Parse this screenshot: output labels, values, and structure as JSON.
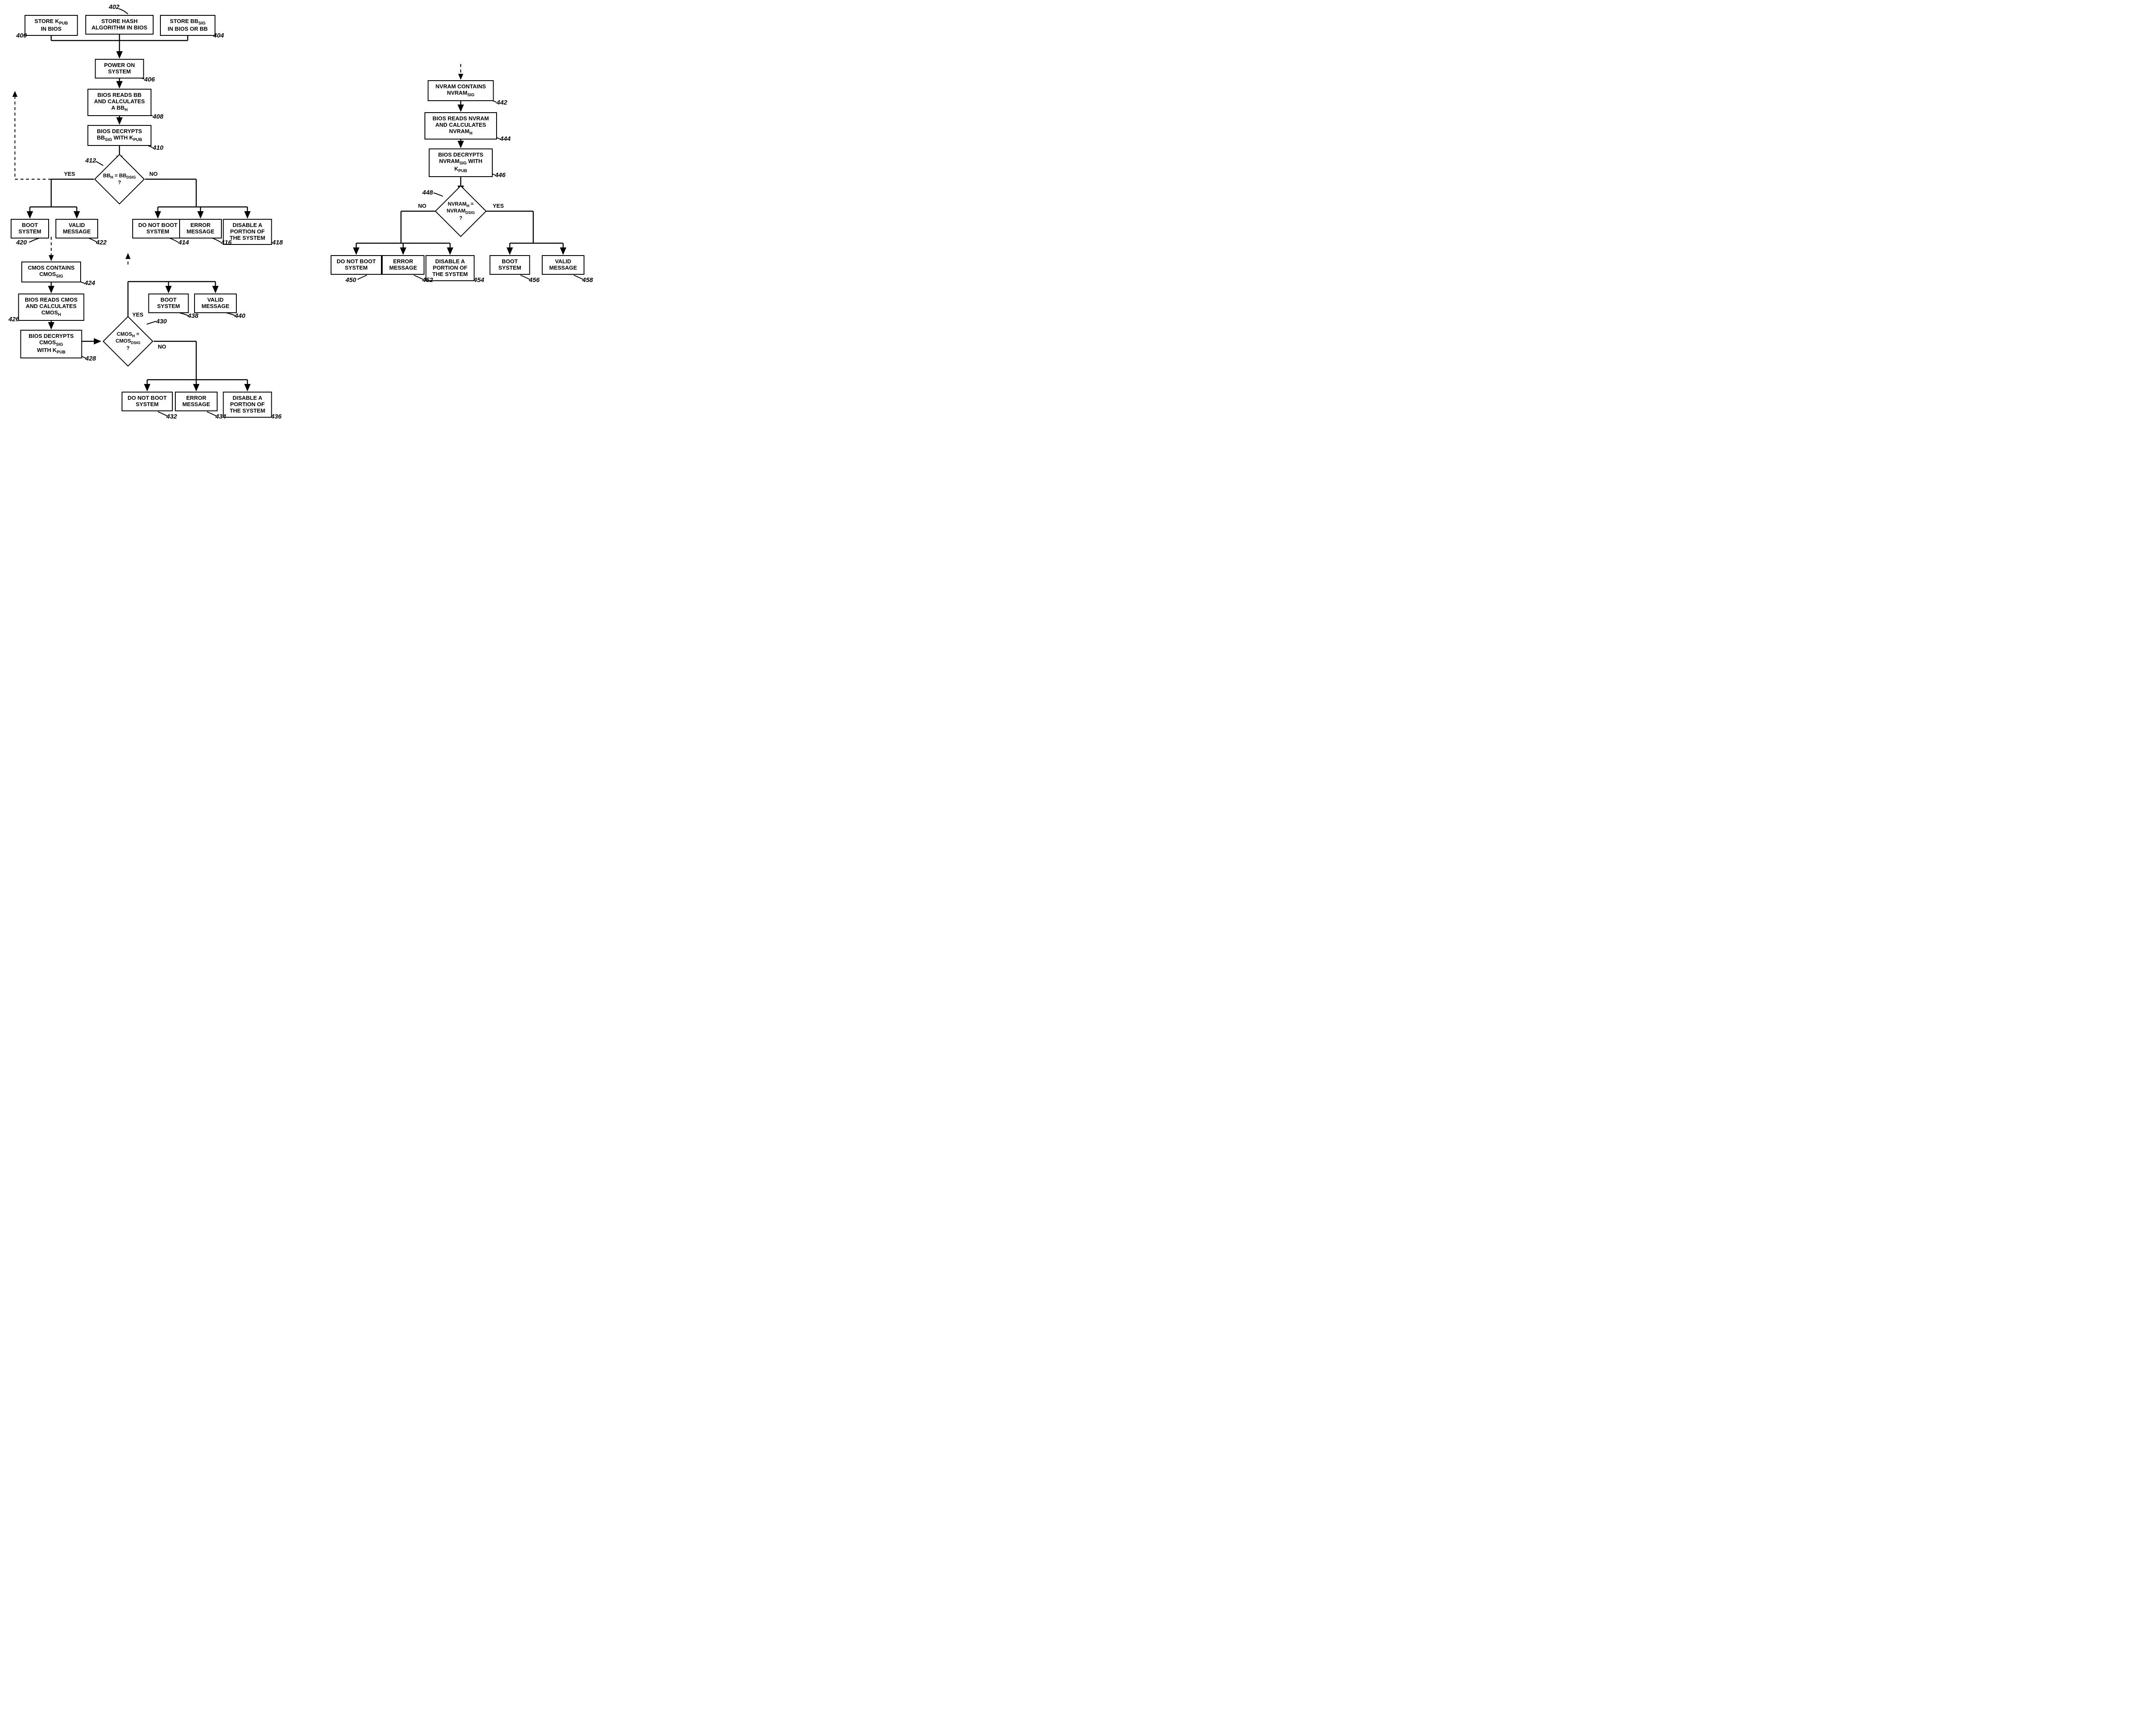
{
  "left": {
    "b400": "STORE K<sub>PUB</sub><br>IN BIOS",
    "b402": "STORE HASH<br>ALGORITHM IN BIOS",
    "b404": "STORE BB<sub>SIG</sub><br>IN BIOS OR BB",
    "b406": "POWER ON<br>SYSTEM",
    "b408": "BIOS READS BB<br>AND CALCULATES<br>A  BB<sub>H</sub>",
    "b410": "BIOS DECRYPTS<br>BB<sub>SIG</sub> WITH K<sub>PUB</sub>",
    "d412": "BB<sub>H</sub> = BB<sub>DSIG</sub><br>?",
    "b414": "DO NOT BOOT<br>SYSTEM",
    "b416": "ERROR<br>MESSAGE",
    "b418": "DISABLE A<br>PORTION OF<br>THE SYSTEM",
    "b420": "BOOT<br>SYSTEM",
    "b422": "VALID<br>MESSAGE",
    "b424": "CMOS CONTAINS<br>CMOS<sub>SIG</sub>",
    "b426": "BIOS READS CMOS<br>AND CALCULATES<br>CMOS<sub>H</sub>",
    "b428": "BIOS DECRYPTS<br>CMOS<sub>SIG</sub><br>WITH K<sub>PUB</sub>",
    "d430": "CMOS<sub>H</sub> =<br>CMOS<sub>DSIG</sub><br>?",
    "b432": "DO NOT BOOT<br>SYSTEM",
    "b434": "ERROR<br>MESSAGE",
    "b436": "DISABLE A<br>PORTION OF<br>THE SYSTEM",
    "b438": "BOOT<br>SYSTEM",
    "b440": "VALID<br>MESSAGE",
    "yes": "YES",
    "no": "NO"
  },
  "right": {
    "b442": "NVRAM CONTAINS<br>NVRAM<sub>SIG</sub>",
    "b444": "BIOS READS NVRAM<br>AND CALCULATES<br>NVRAM<sub>H</sub>",
    "b446": "BIOS DECRYPTS<br>NVRAM<sub>SIG</sub> WITH<br>K<sub>PUB</sub>",
    "d448": "NVRAM<sub>H</sub> =<br>NVRAM<sub>DSIG</sub><br>?",
    "b450": "DO NOT BOOT<br>SYSTEM",
    "b452": "ERROR<br>MESSAGE",
    "b454": "DISABLE A<br>PORTION OF<br>THE SYSTEM",
    "b456": "BOOT<br>SYSTEM",
    "b458": "VALID<br>MESSAGE",
    "yes": "YES",
    "no": "NO"
  },
  "refs": {
    "r400": "400",
    "r402": "402",
    "r404": "404",
    "r406": "406",
    "r408": "408",
    "r410": "410",
    "r412": "412",
    "r414": "414",
    "r416": "416",
    "r418": "418",
    "r420": "420",
    "r422": "422",
    "r424": "424",
    "r426": "426",
    "r428": "428",
    "r430": "430",
    "r432": "432",
    "r434": "434",
    "r436": "436",
    "r438": "438",
    "r440": "440",
    "r442": "442",
    "r444": "444",
    "r446": "446",
    "r448": "448",
    "r450": "450",
    "r452": "452",
    "r454": "454",
    "r456": "456",
    "r458": "458"
  }
}
